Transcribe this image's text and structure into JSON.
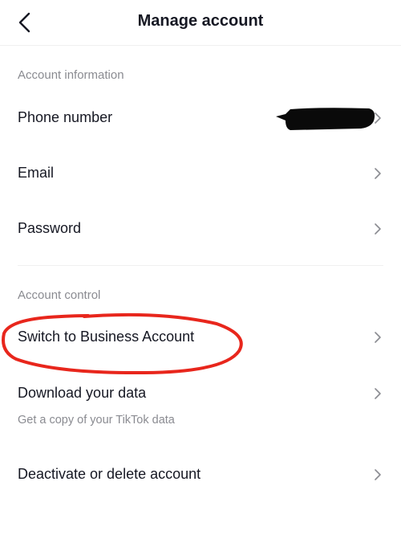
{
  "header": {
    "title": "Manage account",
    "back_icon": "chevron-left-icon"
  },
  "sections": [
    {
      "label": "Account information",
      "items": [
        {
          "label": "Phone number",
          "value": "[redacted]"
        },
        {
          "label": "Email"
        },
        {
          "label": "Password"
        }
      ]
    },
    {
      "label": "Account control",
      "items": [
        {
          "label": "Switch to Business Account",
          "highlighted": true
        },
        {
          "label": "Download your data",
          "subtitle": "Get a copy of your TikTok data"
        },
        {
          "label": "Deactivate or delete account"
        }
      ]
    }
  ],
  "annotation": {
    "color": "#e8261c",
    "shape": "hand-drawn ellipse"
  },
  "colors": {
    "text": "#161823",
    "secondary": "#8a8b91",
    "divider": "#f0f0f0"
  }
}
